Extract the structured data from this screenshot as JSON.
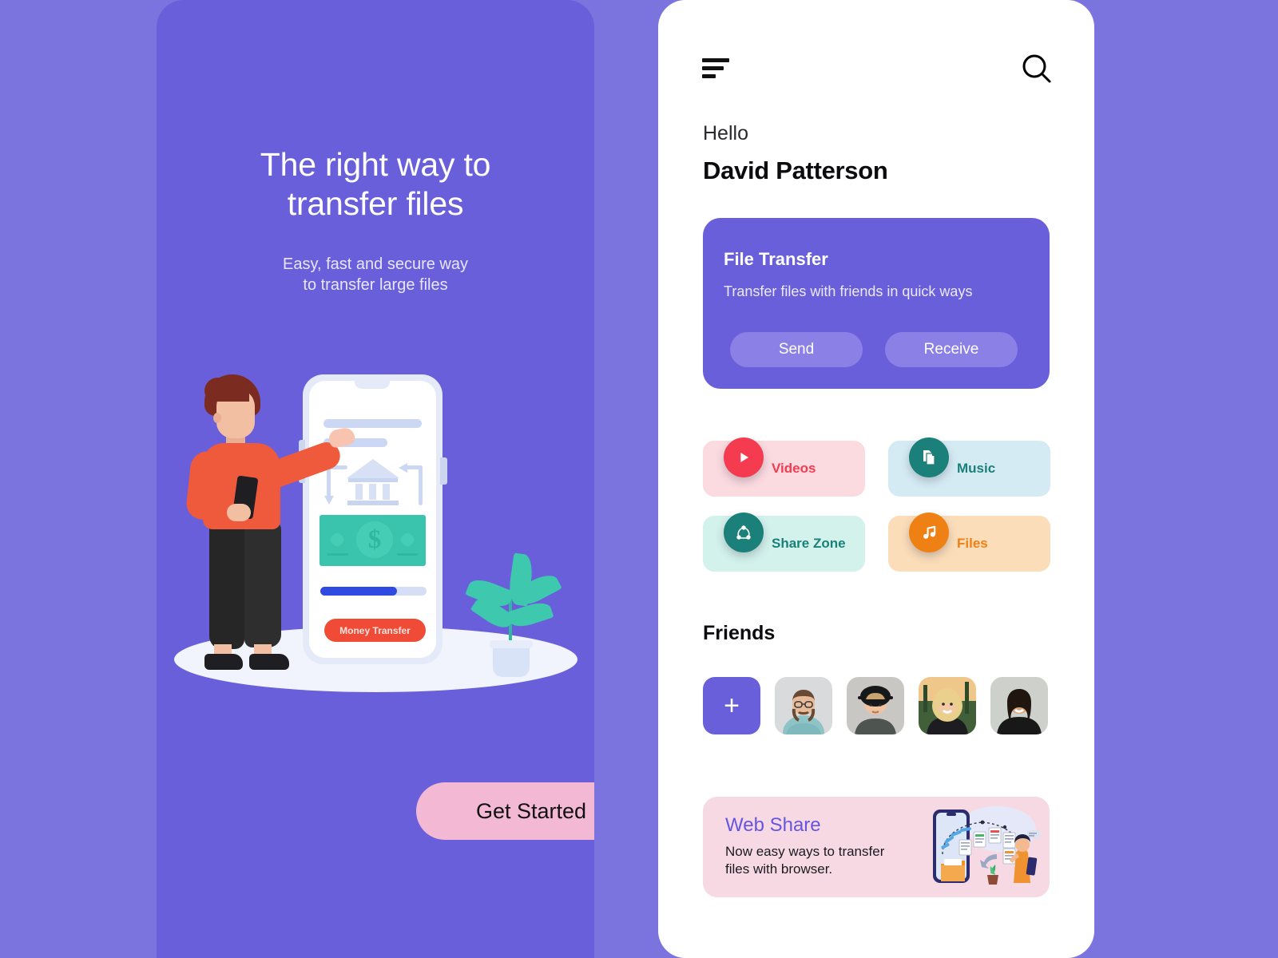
{
  "theme": {
    "page_background": "#7c74de",
    "onboarding_card_bg": "#6a5fdb",
    "app_card_bg": "#ffffff",
    "accent_purple": "#6a5fdb",
    "cta_pink": "#f3b9d4"
  },
  "onboarding": {
    "title_line1": "The right way to",
    "title_line2": "transfer files",
    "subtitle_line1": "Easy, fast and secure way",
    "subtitle_line2": "to transfer large files",
    "cta_label": "Get Started",
    "illustration": {
      "phone_button_label": "Money Transfer",
      "currency_symbol": "$",
      "progress_percent": 72
    }
  },
  "app": {
    "topbar": {
      "menu_icon": "hamburger-icon",
      "search_icon": "search-icon"
    },
    "greeting": "Hello",
    "username": "David Patterson",
    "file_transfer": {
      "title": "File Transfer",
      "subtitle": "Transfer files with friends in quick ways",
      "send_label": "Send",
      "receive_label": "Receive"
    },
    "categories": [
      {
        "label": "Videos",
        "icon": "play-icon",
        "bg": "#fbdbe0",
        "icon_bg": "#f53b50",
        "text": "#f53b50"
      },
      {
        "label": "Music",
        "icon": "document-icon",
        "bg": "#d5ebf4",
        "icon_bg": "#1a8079",
        "text": "#1a8079"
      },
      {
        "label": "Share Zone",
        "icon": "share-icon",
        "bg": "#d3f2ec",
        "icon_bg": "#1a8079",
        "text": "#1a8079"
      },
      {
        "label": "Files",
        "icon": "music-note-icon",
        "bg": "#fbddb9",
        "icon_bg": "#ef8013",
        "text": "#ef8013"
      }
    ],
    "friends": {
      "heading": "Friends",
      "add_label": "+",
      "avatars": [
        {
          "name": "friend-avatar-1"
        },
        {
          "name": "friend-avatar-2"
        },
        {
          "name": "friend-avatar-3"
        },
        {
          "name": "friend-avatar-4"
        }
      ]
    },
    "web_share": {
      "title": "Web Share",
      "description_line1": "Now easy ways to transfer",
      "description_line2": "files with browser."
    }
  }
}
